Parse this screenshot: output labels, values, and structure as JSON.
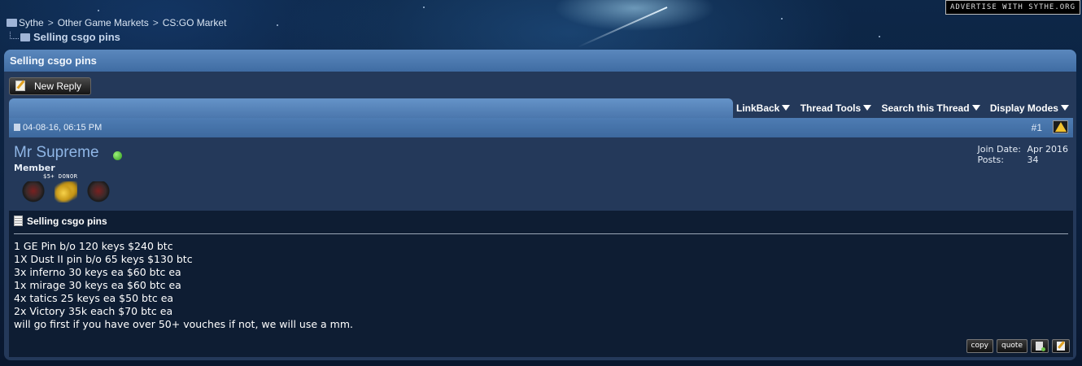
{
  "advert": {
    "label": "Advertise with Sythe.org"
  },
  "breadcrumb": {
    "items": [
      "Sythe",
      "Other Game Markets",
      "CS:GO Market"
    ],
    "separator": ">",
    "current": "Selling csgo pins"
  },
  "thread": {
    "title": "Selling csgo pins",
    "new_reply_label": "New Reply",
    "menus": [
      "LinkBack",
      "Thread Tools",
      "Search this Thread",
      "Display Modes"
    ]
  },
  "post": {
    "date": "04-08-16, 06:15 PM",
    "number": "#1",
    "user": {
      "name": "Mr Supreme",
      "online": true,
      "title": "Member",
      "donor_label": "$5+ DONOR",
      "join_date_label": "Join Date:",
      "join_date": "Apr 2016",
      "posts_label": "Posts:",
      "posts": "34",
      "badges": [
        "skull-badge",
        "coins-badge",
        "skull-badge"
      ]
    },
    "title": "Selling csgo pins",
    "lines": [
      "1 GE Pin b/o 120 keys $240 btc",
      "1X Dust II pin b/o 65 keys $130 btc",
      "3x inferno 30 keys ea $60 btc ea",
      "1x mirage 30 keys ea $60 btc ea",
      "4x tatics 25 keys ea $50 btc ea",
      "2x Victory 35k each $70 btc ea",
      "will go first if you have over 50+ vouches if not, we will use a mm."
    ],
    "actions": {
      "copy": "copy",
      "quote": "quote"
    }
  },
  "colors": {
    "panel_header": "#4f7db4",
    "panel_bg": "#24395a",
    "post_body_bg": "#0e1d33",
    "username": "#8fb6e6",
    "online": "#3fbf22"
  }
}
